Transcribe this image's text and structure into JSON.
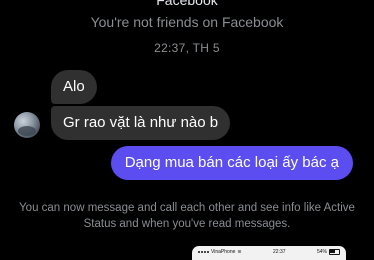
{
  "header": {
    "title": "Facebook",
    "subtitle": "You're not friends on Facebook"
  },
  "conversation": {
    "timestamp": "22:37, TH 5",
    "messages": [
      {
        "direction": "incoming",
        "text": "Alo"
      },
      {
        "direction": "incoming",
        "text": "Gr rao vặt là như nào b"
      },
      {
        "direction": "outgoing",
        "text": "Dạng mua bán các loại ấy bác ạ"
      }
    ],
    "info": "You can now message and call each other and see info like Active Status and when you've read messages."
  },
  "attachment": {
    "status": {
      "carrier": "VinaPhone",
      "time": "22:37",
      "battery": "54%",
      "battery_level": 0.54
    }
  },
  "colors": {
    "background": "#000000",
    "outgoing_bubble": "#5b4df0",
    "incoming_bubble": "#303030",
    "muted_text": "#8a8d91"
  }
}
